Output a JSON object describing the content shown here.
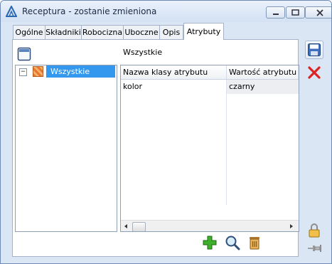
{
  "window": {
    "title": "Receptura - zostanie zmieniona"
  },
  "tabs": [
    {
      "label": "Ogólne"
    },
    {
      "label": "Składniki"
    },
    {
      "label": "Robocizna"
    },
    {
      "label": "Uboczne"
    },
    {
      "label": "Opis"
    },
    {
      "label": "Atrybuty",
      "active": true
    }
  ],
  "panel": {
    "section_label": "Wszystkie",
    "tree": {
      "nodes": [
        {
          "expander": "−",
          "label": "Wszystkie",
          "selected": true
        }
      ]
    },
    "grid": {
      "columns": [
        "Nazwa klasy atrybutu",
        "Wartość atrybutu"
      ],
      "rows": [
        [
          "kolor",
          "czarny"
        ]
      ]
    }
  },
  "icons": {
    "app": "comarch-logo-icon",
    "panel_toggle": "panel-toggle-icon",
    "add": "add-plus-icon",
    "search": "magnifier-icon",
    "delete": "trash-icon",
    "save": "floppy-save-icon",
    "cancel": "red-x-icon",
    "lock": "padlock-icon",
    "pin": "pin-icon"
  },
  "colors": {
    "selection": "#3398ee",
    "window_bg": "#dbe6f4",
    "add_green": "#3fae2a",
    "cancel_red": "#d22"
  }
}
